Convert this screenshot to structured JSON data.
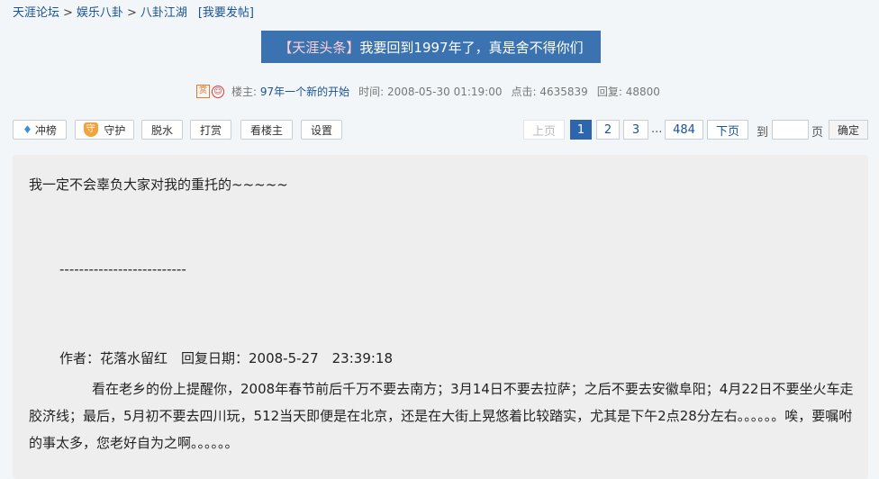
{
  "breadcrumb": {
    "forum": "天涯论坛",
    "section": "娱乐八卦",
    "board": "八卦江湖",
    "post_link": "[我要发帖]",
    "separator": ">"
  },
  "title": {
    "tag": "【天涯头条】",
    "text": "我要回到1997年了，真是舍不得你们"
  },
  "meta": {
    "badge": "赏",
    "owner_label": "楼主:",
    "author": "97年一个新的开始",
    "time_label": "时间:",
    "time": "2008-05-30 01:19:00",
    "clicks_label": "点击:",
    "clicks": "4635839",
    "replies_label": "回复:",
    "replies": "48800"
  },
  "toolbar": {
    "rank": "冲榜",
    "guard": "守护",
    "guard_icon_text": "守",
    "dewater": "脱水",
    "tip": "打赏",
    "owner_only": "看楼主",
    "settings": "设置"
  },
  "pager": {
    "prev": "上页",
    "pages": [
      "1",
      "2",
      "3"
    ],
    "ellipsis": "...",
    "last": "484",
    "next": "下页",
    "to_label": "到",
    "page_label": "页",
    "confirm": "确定"
  },
  "post": {
    "line1": "我一定不会辜负大家对我的重托的~~~~~",
    "divider": "--------------------------",
    "quote_header": "作者：花落水留红　回复日期：2008-5-27　23:39:18",
    "paragraph": "看在老乡的份上提醒你，2008年春节前后千万不要去南方；3月14日不要去拉萨；之后不要去安徽阜阳；4月22日不要坐火车走胶济线；最后，5月初不要去四川玩，512当天即便是在北京，还是在大街上晃悠着比较踏实，尤其是下午2点28分左右。。。。。。唉，要嘱咐的事太多，您老好自为之啊。。。。。。"
  }
}
